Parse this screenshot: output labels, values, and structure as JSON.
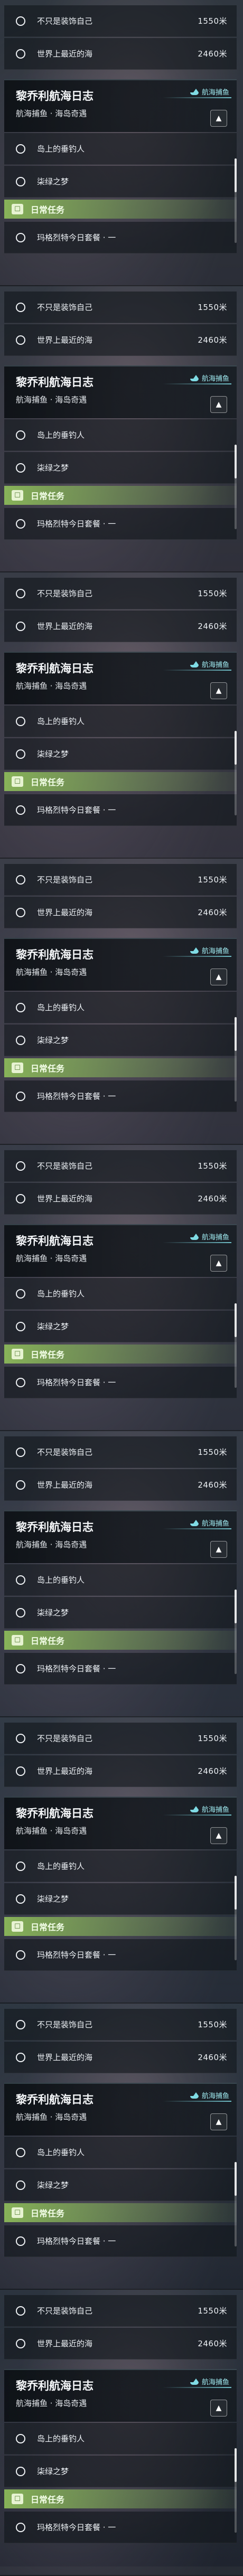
{
  "panel": {
    "quests": [
      {
        "label": "不只是装饰自己",
        "distance": "1550米"
      },
      {
        "label": "世界上最近的海",
        "distance": "2460米"
      }
    ],
    "section": {
      "title": "黎乔利航海日志",
      "subtitle": "航海捕鱼 · 海岛奇遇",
      "tag": "航海捕鱼",
      "collapse_icon": "chevron-up-icon"
    },
    "sub_quests": [
      {
        "label": "岛上的垂钓人"
      },
      {
        "label": "柒绿之梦"
      }
    ],
    "daily": {
      "label": "日常任务",
      "icon": "calendar-icon",
      "accent": "#8cb95a"
    },
    "daily_quests": [
      {
        "label": "玛格烈特今日套餐 · 一"
      }
    ]
  }
}
